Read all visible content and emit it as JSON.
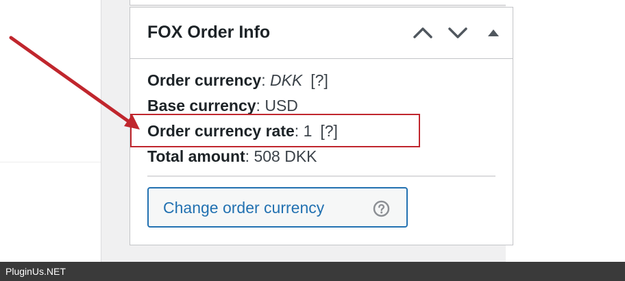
{
  "colors": {
    "page_background": "#f0f0f1",
    "panel_border": "#c3c4c7",
    "title_text": "#1d2327",
    "link_blue": "#2271b1",
    "annotation_red": "#c0262d",
    "footer_background": "#3a3a3a"
  },
  "metabox": {
    "title": "FOX Order Info",
    "controls": {
      "move_up_icon": "chevron-up-icon",
      "move_down_icon": "chevron-down-icon",
      "toggle_icon": "caret-up-icon"
    }
  },
  "order_info": {
    "rows": [
      {
        "label": "Order currency",
        "value": "DKK",
        "help": "[?]"
      },
      {
        "label": "Base currency",
        "value": "USD"
      },
      {
        "label": "Order currency rate",
        "value": "1",
        "help": "[?]"
      },
      {
        "label": "Total amount",
        "value": "508 DKK"
      }
    ],
    "separator": ":"
  },
  "change_currency_button": {
    "label": "Change order currency",
    "icon": "question-circle-icon"
  },
  "annotation": {
    "arrow_icon": "red-arrow",
    "highlighted_row": "Order currency rate"
  },
  "footer": {
    "watermark": "PluginUs.NET"
  }
}
